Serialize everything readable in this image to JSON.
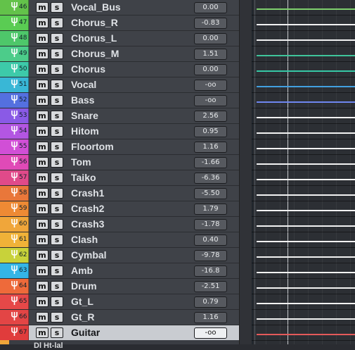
{
  "tracks": [
    {
      "num": "46",
      "name": "Vocal_Bus",
      "volume": "0.00",
      "color": "#63c24a",
      "line": "#7fd06d"
    },
    {
      "num": "47",
      "name": "Chorus_R",
      "volume": "-0.83",
      "color": "#5acc53",
      "line": "#f2f2f2"
    },
    {
      "num": "48",
      "name": "Chorus_L",
      "volume": "0.00",
      "color": "#4ec76a",
      "line": "#f2f2f2"
    },
    {
      "num": "49",
      "name": "Chorus_M",
      "volume": "1.51",
      "color": "#4ccc8a",
      "line": "#3fc59b"
    },
    {
      "num": "50",
      "name": "Chorus",
      "volume": "0.00",
      "color": "#3dcaa9",
      "line": "#36c8a6"
    },
    {
      "num": "51",
      "name": "Vocal",
      "volume": "-oo",
      "color": "#39b7d6",
      "line": "#42a0e0"
    },
    {
      "num": "52",
      "name": "Bass",
      "volume": "-oo",
      "color": "#5470e0",
      "line": "#6f86f0"
    },
    {
      "num": "53",
      "name": "Snare",
      "volume": "2.56",
      "color": "#8a5ae6",
      "line": "#f2f2f2"
    },
    {
      "num": "54",
      "name": "Hitom",
      "volume": "0.95",
      "color": "#b356e2",
      "line": "#f2f2f2"
    },
    {
      "num": "55",
      "name": "Floortom",
      "volume": "1.16",
      "color": "#d14fd6",
      "line": "#f2f2f2"
    },
    {
      "num": "56",
      "name": "Tom",
      "volume": "-1.66",
      "color": "#e04ab7",
      "line": "#f2f2f2"
    },
    {
      "num": "57",
      "name": "Taiko",
      "volume": "-6.36",
      "color": "#e04a8a",
      "line": "#f2f2f2"
    },
    {
      "num": "58",
      "name": "Crash1",
      "volume": "-5.50",
      "color": "#e9773a",
      "line": "#f2f2f2"
    },
    {
      "num": "59",
      "name": "Crash2",
      "volume": "1.79",
      "color": "#ee8a34",
      "line": "#f2f2f2"
    },
    {
      "num": "60",
      "name": "Crash3",
      "volume": "-1.78",
      "color": "#f0a63a",
      "line": "#f2f2f2"
    },
    {
      "num": "61",
      "name": "Clash",
      "volume": "0.40",
      "color": "#f0b238",
      "line": "#f2f2f2"
    },
    {
      "num": "62",
      "name": "Cymbal",
      "volume": "-9.78",
      "color": "#c8d23a",
      "line": "#f2f2f2"
    },
    {
      "num": "63",
      "name": "Amb",
      "volume": "-16.8",
      "color": "#34b5e6",
      "line": "#f2f2f2"
    },
    {
      "num": "64",
      "name": "Drum",
      "volume": "-2.51",
      "color": "#ee6a3a",
      "line": "#f2f2f2"
    },
    {
      "num": "65",
      "name": "Gt_L",
      "volume": "0.79",
      "color": "#e64848",
      "line": "#f2f2f2"
    },
    {
      "num": "66",
      "name": "Gt_R",
      "volume": "1.16",
      "color": "#e34545",
      "line": "#f2f2f2"
    },
    {
      "num": "67",
      "name": "Guitar",
      "volume": "-oo",
      "color": "#e03c3c",
      "line": "#e45a5a",
      "selected": true
    }
  ],
  "mute_label": "m",
  "solo_label": "s",
  "bottom_partial_text": "Dl Ht-lal",
  "bottom_color": "#f0a63a"
}
